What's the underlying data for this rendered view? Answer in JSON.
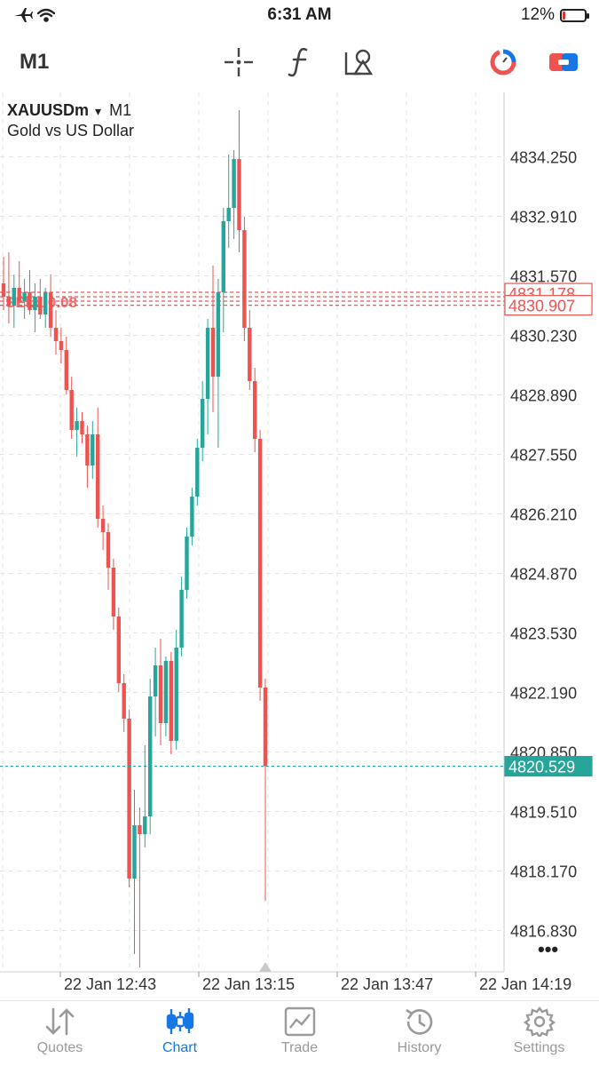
{
  "status_bar": {
    "time": "6:31 AM",
    "battery": "12%",
    "battery_level": 0.12,
    "icons": [
      "airplane-icon",
      "wifi-icon",
      "battery-icon"
    ]
  },
  "toolbar": {
    "timeframe": "M1",
    "icons": [
      "crosshair-icon",
      "indicators-icon",
      "objects-icon",
      "one-click-trading-icon",
      "trade-icon"
    ]
  },
  "chart_header": {
    "symbol": "XAUUSDm",
    "arrow": "▾",
    "timeframe": "M1",
    "description": "Gold vs US Dollar"
  },
  "colors": {
    "bull": "#26a69a",
    "bear": "#ef5350",
    "grid": "#e3e3e3",
    "bid_line": "#26a69a",
    "order_line": "#ef5350",
    "accent": "#1677e5"
  },
  "chart_data": {
    "type": "candlestick",
    "ylim": [
      4815.9,
      4835.7
    ],
    "y_ticks": [
      "4834.250",
      "4832.910",
      "4831.570",
      "4830.230",
      "4828.890",
      "4827.550",
      "4826.210",
      "4824.870",
      "4823.530",
      "4822.190",
      "4820.850",
      "4819.510",
      "4818.170",
      "4816.830"
    ],
    "x_ticks": [
      "22 Jan 12:43",
      "22 Jan 13:15",
      "22 Jan 13:47",
      "22 Jan 14:19"
    ],
    "price_labels": [
      {
        "label": "4831.178",
        "value": 4831.178,
        "style": "order"
      },
      {
        "label": "4830.907",
        "value": 4830.907,
        "style": "order"
      },
      {
        "label": "4820.529",
        "value": 4820.529,
        "style": "bid"
      }
    ],
    "order_lines": [
      4831.2,
      4831.1,
      4831.0,
      4830.907
    ],
    "order_line_text": "SELL 0.08",
    "bid": 4820.529,
    "candles": [
      {
        "o": 4831.4,
        "h": 4832.0,
        "l": 4830.8,
        "c": 4831.1
      },
      {
        "o": 4831.1,
        "h": 4832.1,
        "l": 4830.5,
        "c": 4830.9
      },
      {
        "o": 4830.9,
        "h": 4831.6,
        "l": 4830.4,
        "c": 4831.3
      },
      {
        "o": 4831.3,
        "h": 4831.9,
        "l": 4830.9,
        "c": 4831.0
      },
      {
        "o": 4831.0,
        "h": 4831.5,
        "l": 4830.6,
        "c": 4831.2
      },
      {
        "o": 4831.2,
        "h": 4831.7,
        "l": 4830.7,
        "c": 4830.8
      },
      {
        "o": 4830.8,
        "h": 4831.4,
        "l": 4830.3,
        "c": 4831.1
      },
      {
        "o": 4831.1,
        "h": 4831.5,
        "l": 4830.6,
        "c": 4830.7
      },
      {
        "o": 4830.7,
        "h": 4831.3,
        "l": 4830.4,
        "c": 4831.2
      },
      {
        "o": 4831.2,
        "h": 4831.6,
        "l": 4830.2,
        "c": 4830.4
      },
      {
        "o": 4830.4,
        "h": 4830.8,
        "l": 4829.8,
        "c": 4830.1
      },
      {
        "o": 4830.1,
        "h": 4830.4,
        "l": 4829.6,
        "c": 4829.9
      },
      {
        "o": 4829.9,
        "h": 4830.2,
        "l": 4828.9,
        "c": 4829.0
      },
      {
        "o": 4829.0,
        "h": 4829.3,
        "l": 4827.9,
        "c": 4828.1
      },
      {
        "o": 4828.1,
        "h": 4828.6,
        "l": 4827.5,
        "c": 4828.3
      },
      {
        "o": 4828.3,
        "h": 4828.5,
        "l": 4827.8,
        "c": 4828.0
      },
      {
        "o": 4828.0,
        "h": 4828.2,
        "l": 4826.8,
        "c": 4827.3
      },
      {
        "o": 4827.3,
        "h": 4828.3,
        "l": 4827.0,
        "c": 4828.0
      },
      {
        "o": 4828.0,
        "h": 4828.6,
        "l": 4825.9,
        "c": 4826.1
      },
      {
        "o": 4826.1,
        "h": 4826.4,
        "l": 4825.4,
        "c": 4825.8
      },
      {
        "o": 4825.8,
        "h": 4826.0,
        "l": 4824.5,
        "c": 4825.0
      },
      {
        "o": 4825.0,
        "h": 4825.2,
        "l": 4823.6,
        "c": 4823.9
      },
      {
        "o": 4823.9,
        "h": 4824.1,
        "l": 4822.2,
        "c": 4822.4
      },
      {
        "o": 4822.4,
        "h": 4822.6,
        "l": 4821.3,
        "c": 4821.6
      },
      {
        "o": 4821.6,
        "h": 4821.8,
        "l": 4817.8,
        "c": 4818.0
      },
      {
        "o": 4818.0,
        "h": 4820.0,
        "l": 4816.3,
        "c": 4819.2
      },
      {
        "o": 4819.2,
        "h": 4819.6,
        "l": 4816.0,
        "c": 4819.0
      },
      {
        "o": 4819.0,
        "h": 4821.0,
        "l": 4818.7,
        "c": 4819.4
      },
      {
        "o": 4819.4,
        "h": 4822.5,
        "l": 4819.0,
        "c": 4822.1
      },
      {
        "o": 4822.1,
        "h": 4823.2,
        "l": 4821.2,
        "c": 4822.8
      },
      {
        "o": 4822.8,
        "h": 4823.4,
        "l": 4821.0,
        "c": 4821.5
      },
      {
        "o": 4821.5,
        "h": 4823.0,
        "l": 4821.2,
        "c": 4822.9
      },
      {
        "o": 4822.9,
        "h": 4823.1,
        "l": 4820.8,
        "c": 4821.1
      },
      {
        "o": 4821.1,
        "h": 4823.6,
        "l": 4820.9,
        "c": 4823.2
      },
      {
        "o": 4823.2,
        "h": 4824.8,
        "l": 4823.0,
        "c": 4824.5
      },
      {
        "o": 4824.5,
        "h": 4825.9,
        "l": 4824.3,
        "c": 4825.7
      },
      {
        "o": 4825.7,
        "h": 4826.8,
        "l": 4825.5,
        "c": 4826.6
      },
      {
        "o": 4826.6,
        "h": 4827.9,
        "l": 4826.4,
        "c": 4827.7
      },
      {
        "o": 4827.7,
        "h": 4829.2,
        "l": 4827.4,
        "c": 4828.8
      },
      {
        "o": 4828.8,
        "h": 4830.6,
        "l": 4828.0,
        "c": 4830.4
      },
      {
        "o": 4830.4,
        "h": 4831.8,
        "l": 4828.5,
        "c": 4829.3
      },
      {
        "o": 4829.3,
        "h": 4831.5,
        "l": 4827.7,
        "c": 4831.2
      },
      {
        "o": 4831.2,
        "h": 4833.1,
        "l": 4830.3,
        "c": 4832.8
      },
      {
        "o": 4832.8,
        "h": 4834.3,
        "l": 4832.2,
        "c": 4833.1
      },
      {
        "o": 4833.1,
        "h": 4834.4,
        "l": 4832.4,
        "c": 4834.2
      },
      {
        "o": 4834.2,
        "h": 4835.3,
        "l": 4832.1,
        "c": 4832.6
      },
      {
        "o": 4832.6,
        "h": 4832.9,
        "l": 4830.1,
        "c": 4830.4
      },
      {
        "o": 4830.4,
        "h": 4830.8,
        "l": 4829.0,
        "c": 4829.2
      },
      {
        "o": 4829.2,
        "h": 4829.5,
        "l": 4827.6,
        "c": 4827.9
      },
      {
        "o": 4827.9,
        "h": 4828.1,
        "l": 4822.0,
        "c": 4822.3
      },
      {
        "o": 4822.3,
        "h": 4822.5,
        "l": 4817.5,
        "c": 4820.53
      }
    ]
  },
  "more_label": "•••",
  "bottom_nav": [
    {
      "label": "Quotes",
      "icon": "quotes-icon",
      "active": false
    },
    {
      "label": "Chart",
      "icon": "chart-icon",
      "active": true
    },
    {
      "label": "Trade",
      "icon": "trade-icon",
      "active": false
    },
    {
      "label": "History",
      "icon": "history-icon",
      "active": false
    },
    {
      "label": "Settings",
      "icon": "settings-icon",
      "active": false
    }
  ]
}
